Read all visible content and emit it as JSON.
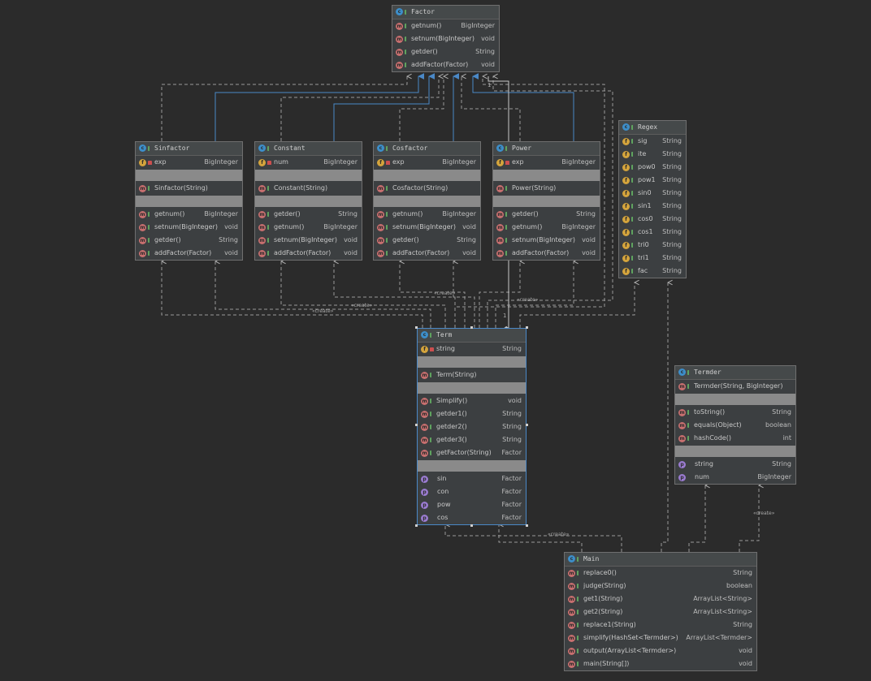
{
  "classes": {
    "Factor": {
      "name": "Factor",
      "sections": [
        [
          {
            "icon": "m",
            "vis": "pub",
            "name": "getnum()",
            "type": "BigInteger"
          },
          {
            "icon": "m",
            "vis": "pub",
            "name": "setnum(BigInteger)",
            "type": "void"
          },
          {
            "icon": "m",
            "vis": "pub",
            "name": "getder()",
            "type": "String"
          },
          {
            "icon": "m",
            "vis": "pub",
            "name": "addFactor(Factor)",
            "type": "void"
          }
        ]
      ]
    },
    "Sinfactor": {
      "name": "Sinfactor",
      "sections": [
        [
          {
            "icon": "f",
            "vis": "priv",
            "name": "exp",
            "type": "BigInteger"
          }
        ],
        [],
        [
          {
            "icon": "m",
            "vis": "pub",
            "name": "Sinfactor(String)",
            "type": ""
          }
        ],
        [],
        [
          {
            "icon": "m",
            "vis": "pub",
            "name": "getnum()",
            "type": "BigInteger"
          },
          {
            "icon": "m",
            "vis": "pub",
            "name": "setnum(BigInteger)",
            "type": "void"
          },
          {
            "icon": "m",
            "vis": "pub",
            "name": "getder()",
            "type": "String"
          },
          {
            "icon": "m",
            "vis": "pub",
            "name": "addFactor(Factor)",
            "type": "void"
          }
        ]
      ]
    },
    "Constant": {
      "name": "Constant",
      "sections": [
        [
          {
            "icon": "f",
            "vis": "priv",
            "name": "num",
            "type": "BigInteger"
          }
        ],
        [],
        [
          {
            "icon": "m",
            "vis": "pub",
            "name": "Constant(String)",
            "type": ""
          }
        ],
        [],
        [
          {
            "icon": "m",
            "vis": "pub",
            "name": "getder()",
            "type": "String"
          },
          {
            "icon": "m",
            "vis": "pub",
            "name": "getnum()",
            "type": "BigInteger"
          },
          {
            "icon": "m",
            "vis": "pub",
            "name": "setnum(BigInteger)",
            "type": "void"
          },
          {
            "icon": "m",
            "vis": "pub",
            "name": "addFactor(Factor)",
            "type": "void"
          }
        ]
      ]
    },
    "Cosfactor": {
      "name": "Cosfactor",
      "sections": [
        [
          {
            "icon": "f",
            "vis": "priv",
            "name": "exp",
            "type": "BigInteger"
          }
        ],
        [],
        [
          {
            "icon": "m",
            "vis": "pub",
            "name": "Cosfactor(String)",
            "type": ""
          }
        ],
        [],
        [
          {
            "icon": "m",
            "vis": "pub",
            "name": "getnum()",
            "type": "BigInteger"
          },
          {
            "icon": "m",
            "vis": "pub",
            "name": "setnum(BigInteger)",
            "type": "void"
          },
          {
            "icon": "m",
            "vis": "pub",
            "name": "getder()",
            "type": "String"
          },
          {
            "icon": "m",
            "vis": "pub",
            "name": "addFactor(Factor)",
            "type": "void"
          }
        ]
      ]
    },
    "Power": {
      "name": "Power",
      "sections": [
        [
          {
            "icon": "f",
            "vis": "priv",
            "name": "exp",
            "type": "BigInteger"
          }
        ],
        [],
        [
          {
            "icon": "m",
            "vis": "pub",
            "name": "Power(String)",
            "type": ""
          }
        ],
        [],
        [
          {
            "icon": "m",
            "vis": "pub",
            "name": "getder()",
            "type": "String"
          },
          {
            "icon": "m",
            "vis": "pub",
            "name": "getnum()",
            "type": "BigInteger"
          },
          {
            "icon": "m",
            "vis": "pub",
            "name": "setnum(BigInteger)",
            "type": "void"
          },
          {
            "icon": "m",
            "vis": "pub",
            "name": "addFactor(Factor)",
            "type": "void"
          }
        ]
      ]
    },
    "Regex": {
      "name": "Regex",
      "sections": [
        [
          {
            "icon": "f",
            "vis": "pub",
            "name": "sig",
            "type": "String"
          },
          {
            "icon": "f",
            "vis": "pub",
            "name": "ite",
            "type": "String"
          },
          {
            "icon": "f",
            "vis": "pub",
            "name": "pow0",
            "type": "String"
          },
          {
            "icon": "f",
            "vis": "pub",
            "name": "pow1",
            "type": "String"
          },
          {
            "icon": "f",
            "vis": "pub",
            "name": "sin0",
            "type": "String"
          },
          {
            "icon": "f",
            "vis": "pub",
            "name": "sin1",
            "type": "String"
          },
          {
            "icon": "f",
            "vis": "pub",
            "name": "cos0",
            "type": "String"
          },
          {
            "icon": "f",
            "vis": "pub",
            "name": "cos1",
            "type": "String"
          },
          {
            "icon": "f",
            "vis": "pub",
            "name": "tri0",
            "type": "String"
          },
          {
            "icon": "f",
            "vis": "pub",
            "name": "tri1",
            "type": "String"
          },
          {
            "icon": "f",
            "vis": "pub",
            "name": "fac",
            "type": "String"
          }
        ]
      ]
    },
    "Term": {
      "name": "Term",
      "sections": [
        [
          {
            "icon": "f",
            "vis": "priv",
            "name": "string",
            "type": "String"
          }
        ],
        [],
        [
          {
            "icon": "m",
            "vis": "pub",
            "name": "Term(String)",
            "type": ""
          }
        ],
        [],
        [
          {
            "icon": "m",
            "vis": "pub",
            "name": "Simplify()",
            "type": "void"
          },
          {
            "icon": "m",
            "vis": "pub",
            "name": "getder1()",
            "type": "String"
          },
          {
            "icon": "m",
            "vis": "pub",
            "name": "getder2()",
            "type": "String"
          },
          {
            "icon": "m",
            "vis": "pub",
            "name": "getder3()",
            "type": "String"
          },
          {
            "icon": "m",
            "vis": "pub",
            "name": "getFactor(String)",
            "type": "Factor"
          }
        ],
        [],
        [
          {
            "icon": "p",
            "vis": "none",
            "name": "sin",
            "type": "Factor"
          },
          {
            "icon": "p",
            "vis": "none",
            "name": "con",
            "type": "Factor"
          },
          {
            "icon": "p",
            "vis": "none",
            "name": "pow",
            "type": "Factor"
          },
          {
            "icon": "p",
            "vis": "none",
            "name": "cos",
            "type": "Factor"
          }
        ]
      ]
    },
    "Termder": {
      "name": "Termder",
      "sections": [
        [
          {
            "icon": "m",
            "vis": "pub",
            "name": "Termder(String, BigInteger)",
            "type": ""
          }
        ],
        [],
        [
          {
            "icon": "m",
            "vis": "pub",
            "name": "toString()",
            "type": "String"
          },
          {
            "icon": "m",
            "vis": "pub",
            "name": "equals(Object)",
            "type": "boolean"
          },
          {
            "icon": "m",
            "vis": "pub",
            "name": "hashCode()",
            "type": "int"
          }
        ],
        [],
        [
          {
            "icon": "p",
            "vis": "none",
            "name": "string",
            "type": "String"
          },
          {
            "icon": "p",
            "vis": "none",
            "name": "num",
            "type": "BigInteger"
          }
        ]
      ]
    },
    "Main": {
      "name": "Main",
      "sections": [
        [
          {
            "icon": "m",
            "vis": "pub",
            "name": "replace0()",
            "type": "String"
          },
          {
            "icon": "m",
            "vis": "pub",
            "name": "judge(String)",
            "type": "boolean"
          },
          {
            "icon": "m",
            "vis": "pub",
            "name": "get1(String)",
            "type": "ArrayList<String>"
          },
          {
            "icon": "m",
            "vis": "pub",
            "name": "get2(String)",
            "type": "ArrayList<String>"
          },
          {
            "icon": "m",
            "vis": "pub",
            "name": "replace1(String)",
            "type": "String"
          },
          {
            "icon": "m",
            "vis": "pub",
            "name": "simplify(HashSet<Termder>)",
            "type": "ArrayList<Termder>"
          },
          {
            "icon": "m",
            "vis": "pub",
            "name": "output(ArrayList<Termder>)",
            "type": "void"
          },
          {
            "icon": "m",
            "vis": "pub",
            "name": "main(String[])",
            "type": "void"
          }
        ]
      ]
    }
  },
  "edge_labels": {
    "create": "«create»",
    "multiplicity_one": "1"
  },
  "colors": {
    "background": "#2b2b2b",
    "box": "#3c3f41",
    "inheritance": "#4a88c7",
    "dependency": "#9a9a9a",
    "selection": "#4a88c7"
  }
}
